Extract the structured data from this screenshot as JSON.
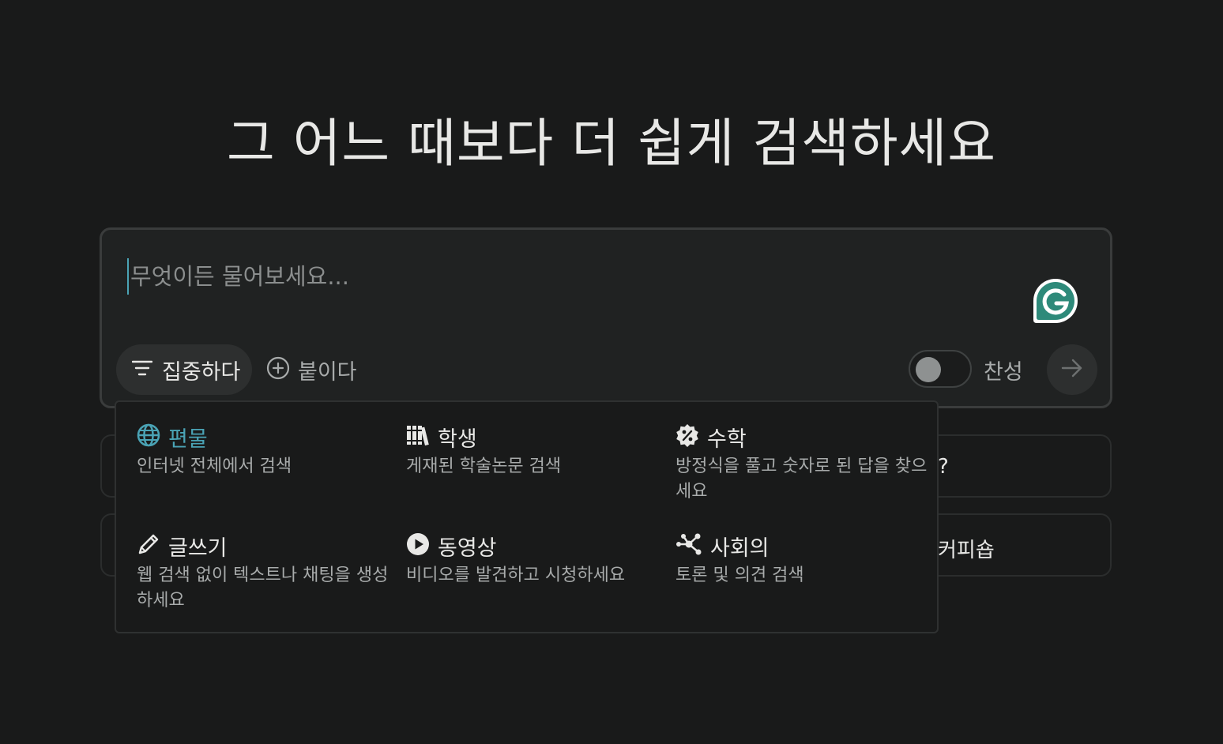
{
  "headline": "그 어느 때보다 더 쉽게 검색하세요",
  "search": {
    "placeholder": "무엇이든 물어보세요..."
  },
  "toolbar": {
    "focus_label": "집중하다",
    "attach_label": "붙이다",
    "pro_label": "찬성"
  },
  "focus_options": [
    {
      "title": "편물",
      "description": "인터넷 전체에서 검색",
      "icon": "globe-icon",
      "active": true
    },
    {
      "title": "학생",
      "description": "게재된 학술논문 검색",
      "icon": "books-icon",
      "active": false
    },
    {
      "title": "수학",
      "description": "방정식을 풀고 숫자로 된 답을 찾으세요",
      "icon": "percent-badge-icon",
      "active": false
    },
    {
      "title": "글쓰기",
      "description": "웹 검색 없이 텍스트나 채팅을 생성하세요",
      "icon": "pencil-icon",
      "active": false
    },
    {
      "title": "동영상",
      "description": "비디오를 발견하고 시청하세요",
      "icon": "play-icon",
      "active": false
    },
    {
      "title": "사회의",
      "description": "토론 및 의견 검색",
      "icon": "network-icon",
      "active": false
    }
  ],
  "suggestions": [
    {
      "text": "?"
    },
    {
      "text": "커피숍"
    }
  ],
  "colors": {
    "background": "#191a1a",
    "accent": "#4aa3b5",
    "grammarly": "#2e8a7a"
  }
}
